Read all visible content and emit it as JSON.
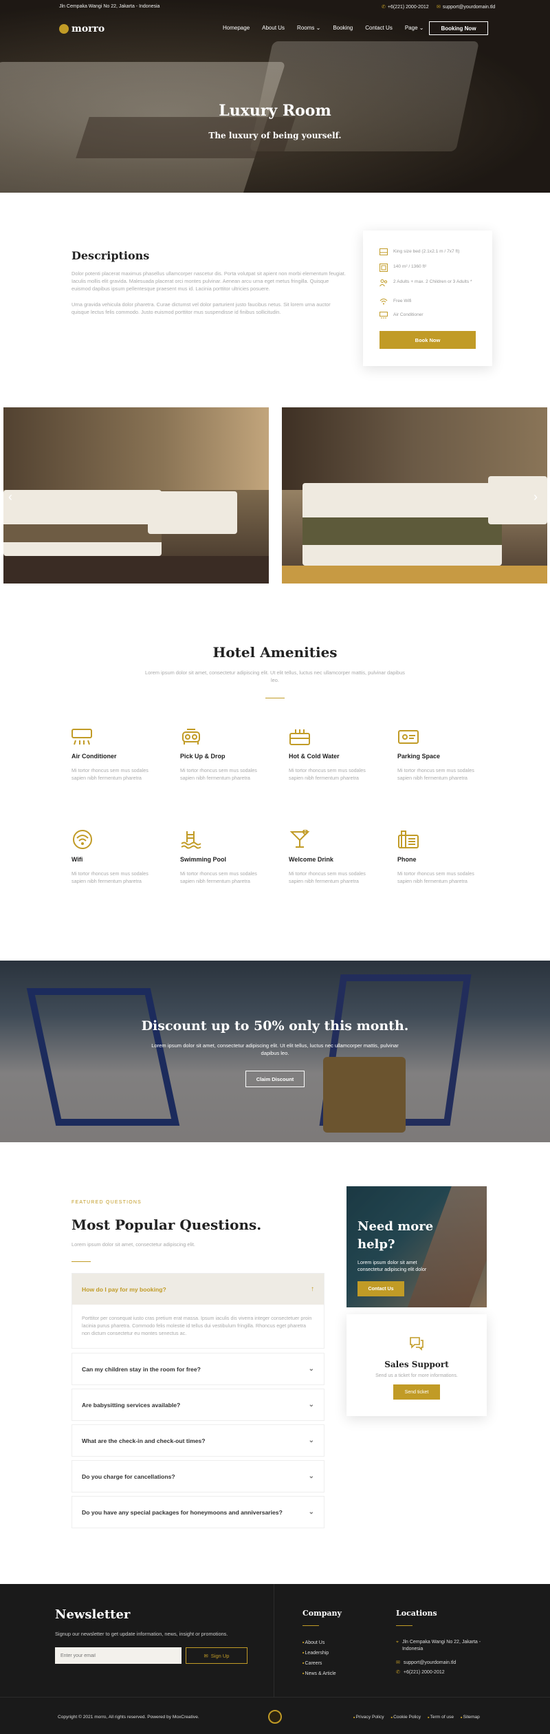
{
  "topbar": {
    "address": "Jln Cempaka Wangi No 22, Jakarta - Indonesia",
    "phone": "+6(221) 2000-2012",
    "email": "support@yourdomain.tld"
  },
  "nav": {
    "logo": "morro",
    "items": [
      "Homepage",
      "About Us",
      "Rooms",
      "Booking",
      "Contact Us",
      "Page"
    ],
    "cta": "Booking Now"
  },
  "hero": {
    "title": "Luxury Room",
    "subtitle": "The luxury of being yourself."
  },
  "description": {
    "title": "Descriptions",
    "p1": "Dolor potenti placerat maximus phasellus ullamcorper nascetur dis. Porta volutpat sit apient non morbi elementum feugiat. Iaculis mollis elit gravida. Malesuada placerat orci montes pulvinar. Aenean arcu urna eget metus fringilla. Quisque euismod dapibus ipsum pellentesque praesent mus id. Lacinia porttitor ultricies posuere.",
    "p2": "Urna gravida vehicula dolor pharetra. Curae dictumst vel dolor parturient justo faucibus netus. Sit lorem urna auctor quisque lectus felis commodo. Justo euismod porttitor mus suspendisse id finibus sollicitudin."
  },
  "features": {
    "items": [
      "King size bed (2.1x2.1 m / 7x7 ft)",
      "140 m² / 1360 ft²",
      "2 Adults + max. 2 Children or 3 Adults *",
      "Free Wifi",
      "Air Conditioner"
    ],
    "button": "Book Now"
  },
  "amenities": {
    "title": "Hotel Amenities",
    "subtitle": "Lorem ipsum dolor sit amet, consectetur adipiscing elit. Ut elit tellus, luctus nec ullamcorper mattis, pulvinar dapibus leo.",
    "items": [
      {
        "name": "Air Conditioner",
        "icon": "air-conditioner-icon",
        "text": "Mi tortor rhoncus sem mus sodales sapien nibh fermentum pharetra"
      },
      {
        "name": "Pick Up & Drop",
        "icon": "car-icon",
        "text": "Mi tortor rhoncus sem mus sodales sapien nibh fermentum pharetra"
      },
      {
        "name": "Hot & Cold Water",
        "icon": "water-heater-icon",
        "text": "Mi tortor rhoncus sem mus sodales sapien nibh fermentum pharetra"
      },
      {
        "name": "Parking Space",
        "icon": "parking-icon",
        "text": "Mi tortor rhoncus sem mus sodales sapien nibh fermentum pharetra"
      },
      {
        "name": "Wifi",
        "icon": "wifi-icon",
        "text": "Mi tortor rhoncus sem mus sodales sapien nibh fermentum pharetra"
      },
      {
        "name": "Swimming Pool",
        "icon": "pool-icon",
        "text": "Mi tortor rhoncus sem mus sodales sapien nibh fermentum pharetra"
      },
      {
        "name": "Welcome Drink",
        "icon": "cocktail-icon",
        "text": "Mi tortor rhoncus sem mus sodales sapien nibh fermentum pharetra"
      },
      {
        "name": "Phone",
        "icon": "phone-icon",
        "text": "Mi tortor rhoncus sem mus sodales sapien nibh fermentum pharetra"
      }
    ]
  },
  "discount": {
    "title": "Discount up to 50% only this month.",
    "text": "Lorem ipsum dolor sit amet, consectetur adipiscing elit. Ut elit tellus, luctus nec ullamcorper mattis, pulvinar dapibus leo.",
    "button": "Claim Discount"
  },
  "faq": {
    "kicker": "FEATURED QUESTIONS",
    "title": "Most Popular Questions.",
    "subtitle": "Lorem ipsum dolor sit amet, consectetur adipiscing elit.",
    "items": [
      {
        "q": "How do I pay for my booking?",
        "a": "Porttitor per consequat iusto cras pretium erat massa. Ipsum iaculis dis viverra integer consectetuer proin lacinia purus pharetra. Commodo felis molestie id tellus dui vestibulum fringilla. Rhoncus eget pharetra non dictum consectetur eu montes senectus ac."
      },
      {
        "q": "Can my children stay in the room for free?"
      },
      {
        "q": "Are babysitting services available?"
      },
      {
        "q": "What are the check-in and check-out times?"
      },
      {
        "q": "Do you charge for cancellations?"
      },
      {
        "q": "Do you have any special packages for honeymoons and anniversaries?"
      }
    ]
  },
  "help": {
    "title": "Need more help?",
    "text": "Lorem ipsum dolor sit amet consectetur adipiscing elit dolor",
    "button": "Contact Us"
  },
  "support": {
    "title": "Sales Support",
    "text": "Send us a ticket for more informations.",
    "button": "Send ticket"
  },
  "newsletter": {
    "title": "Newsletter",
    "text": "Signup our newsletter to get update information, news, insight or promotions.",
    "placeholder": "Enter your email",
    "button": "Sign Up"
  },
  "company": {
    "title": "Company",
    "links": [
      "About Us",
      "Leadership",
      "Careers",
      "News & Article"
    ]
  },
  "locations": {
    "title": "Locations",
    "address": "Jln Cempaka Wangi No 22, Jakarta - Indonesia",
    "email": "support@yourdomain.tld",
    "phone": "+6(221) 2000-2012"
  },
  "footer": {
    "copyright": "Copyright © 2021 morro, All rights reserved. Powered by MoxCreative.",
    "links": [
      "Privacy Policy",
      "Cookie Policy",
      "Term of use",
      "Sitemap"
    ]
  },
  "colors": {
    "accent": "#c19b26",
    "footer_bg": "#1a1a1a"
  }
}
